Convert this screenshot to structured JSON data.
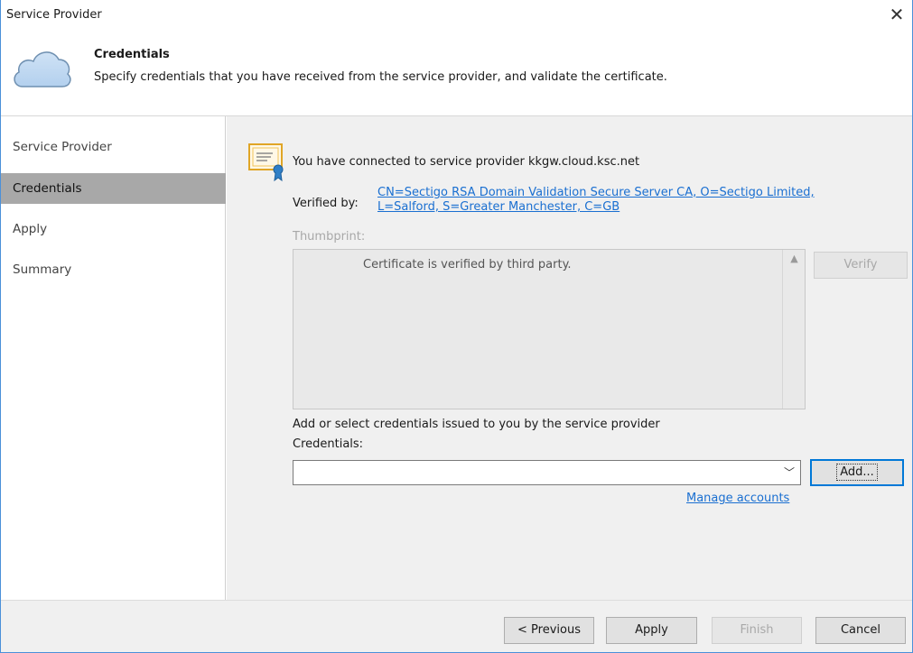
{
  "window": {
    "title": "Service Provider",
    "close_glyph": "✕"
  },
  "header": {
    "title": "Credentials",
    "subtitle": "Specify credentials that you have received from the service provider, and validate the certificate.",
    "icon": "cloud-icon"
  },
  "sidebar": {
    "items": [
      {
        "label": "Service Provider",
        "active": false
      },
      {
        "label": "Credentials",
        "active": true
      },
      {
        "label": "Apply",
        "active": false
      },
      {
        "label": "Summary",
        "active": false
      }
    ]
  },
  "main": {
    "connected_text": "You have connected to service provider kkgw.cloud.ksc.net",
    "verified_label": "Verified by:",
    "verified_link_line1": "CN=Sectigo RSA Domain Validation Secure Server CA, O=Sectigo Limited,",
    "verified_link_line2": "L=Salford, S=Greater Manchester, C=GB",
    "thumbprint_label": "Thumbprint:",
    "thumbprint_text": "Certificate is verified by third party.",
    "verify_button": "Verify",
    "add_select_label": "Add or select credentials issued to you by the service provider",
    "credentials_label": "Credentials:",
    "credentials_value": "",
    "add_button": "Add...",
    "manage_accounts_link": "Manage accounts"
  },
  "footer": {
    "previous_button": "< Previous",
    "apply_button": "Apply",
    "finish_button": "Finish",
    "cancel_button": "Cancel"
  },
  "colors": {
    "link": "#1a6fd1",
    "sidebar_active": "#a8a8a8",
    "panel_bg": "#f0f0f0",
    "window_border": "#4a90d9"
  }
}
